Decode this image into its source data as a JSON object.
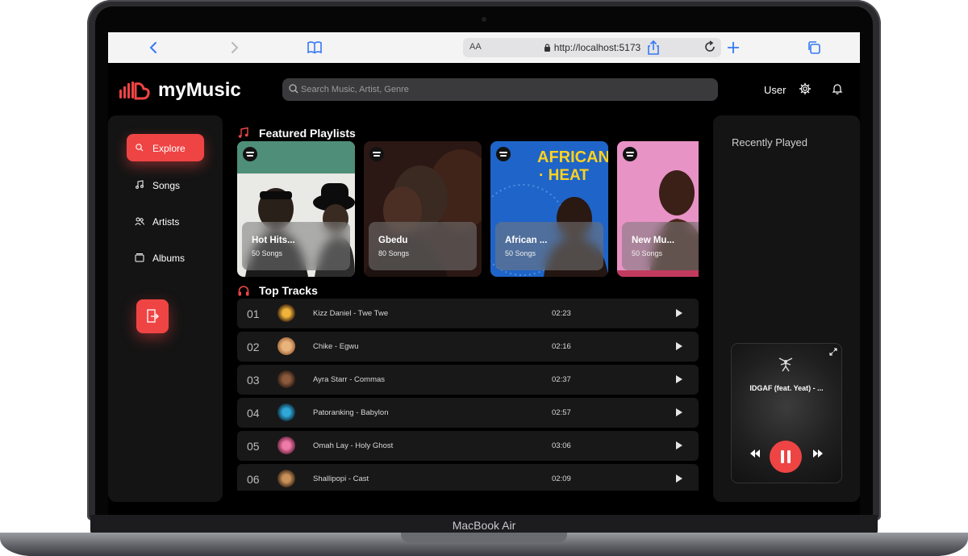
{
  "device": {
    "label": "MacBook Air"
  },
  "browser": {
    "address_prefix": "AA",
    "url": "http://localhost:5173"
  },
  "app": {
    "brand": "myMusic",
    "search_placeholder": "Search Music, Artist, Genre",
    "user_label": "User",
    "accent_color": "#ef4444"
  },
  "sidebar": {
    "items": [
      {
        "label": "Explore",
        "icon": "search-icon",
        "active": true
      },
      {
        "label": "Songs",
        "icon": "music-note-icon",
        "active": false
      },
      {
        "label": "Artists",
        "icon": "users-icon",
        "active": false
      },
      {
        "label": "Albums",
        "icon": "album-icon",
        "active": false
      }
    ]
  },
  "featured": {
    "title": "Featured Playlists",
    "playlists": [
      {
        "name": "Hot Hits...",
        "count": "50 Songs"
      },
      {
        "name": "Gbedu",
        "count": "80 Songs"
      },
      {
        "name": "African ...",
        "count": "50 Songs",
        "cover_text": "AFRICAN · HEAT"
      },
      {
        "name": "New Mu...",
        "count": "50 Songs"
      }
    ]
  },
  "top_tracks": {
    "title": "Top Tracks",
    "tracks": [
      {
        "no": "01",
        "title": "Kizz Daniel - Twe Twe",
        "duration": "02:23"
      },
      {
        "no": "02",
        "title": "Chike - Egwu",
        "duration": "02:16"
      },
      {
        "no": "03",
        "title": "Ayra Starr - Commas",
        "duration": "02:37"
      },
      {
        "no": "04",
        "title": "Patoranking - Babylon",
        "duration": "02:57"
      },
      {
        "no": "05",
        "title": "Omah Lay - Holy Ghost",
        "duration": "03:06"
      },
      {
        "no": "06",
        "title": "Shallipopi - Cast",
        "duration": "02:09"
      }
    ]
  },
  "recently_played": {
    "title": "Recently Played",
    "now_playing": "IDGAF (feat. Yeat) - ..."
  }
}
